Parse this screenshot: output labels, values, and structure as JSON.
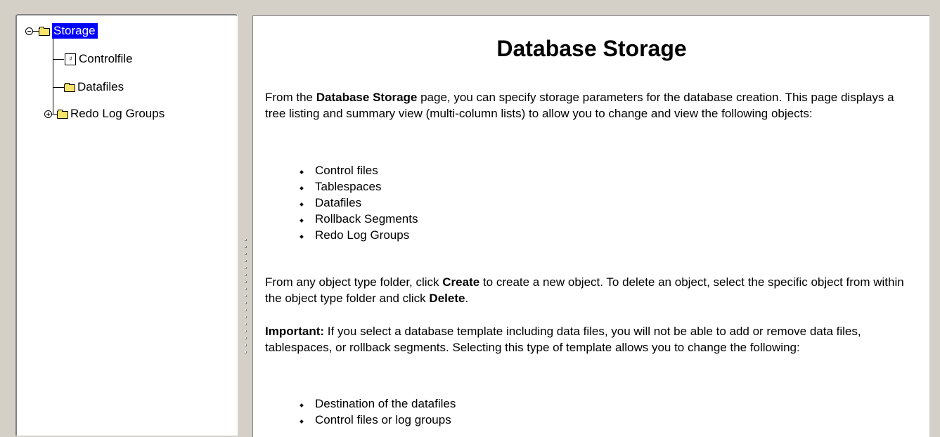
{
  "tree": {
    "root": {
      "label": "Storage",
      "expanded": true,
      "selected": true
    },
    "children": [
      {
        "label": "Controlfile",
        "icon": "controlfile-icon"
      },
      {
        "label": "Datafiles",
        "icon": "folder-icon"
      },
      {
        "label": "Redo Log Groups",
        "icon": "folder-icon",
        "expanded": false
      }
    ]
  },
  "content": {
    "title": "Database Storage",
    "intro": {
      "pre": "From the ",
      "bold": "Database Storage",
      "post": " page, you can specify storage parameters for the database creation. This page displays a tree listing and summary view (multi-column lists) to allow you to change and view the following objects:"
    },
    "objects": [
      "Control files",
      "Tablespaces",
      "Datafiles",
      "Rollback Segments",
      "Redo Log Groups"
    ],
    "create_delete": {
      "p1": "From any object type folder, click ",
      "b1": "Create",
      "p2": " to create a new object. To delete an object, select the specific object from within the object type folder and click ",
      "b2": "Delete",
      "p3": "."
    },
    "important": {
      "label": "Important:",
      "text": " If you select a database template including data files, you will not be able to add or remove data files, tablespaces, or rollback segments. Selecting this type of template allows you to change the following:"
    },
    "template_changes": [
      "Destination of the datafiles",
      "Control files or log groups"
    ]
  },
  "colors": {
    "window_bg": "#d4d0c8",
    "selection": "#0000ff",
    "folder": "#f8e46a"
  }
}
